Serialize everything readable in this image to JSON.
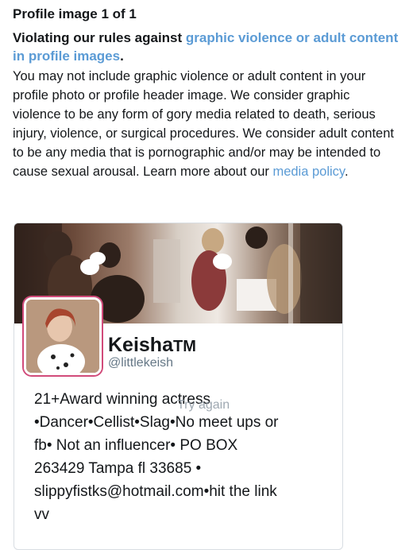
{
  "header": {
    "title": "Profile image 1 of 1"
  },
  "violation": {
    "prefix": "Violating our rules against ",
    "link_text": "graphic violence or adult content in profile images",
    "suffix": "."
  },
  "description": {
    "text": "You may not include graphic violence or adult content in your profile photo or profile header image. We consider graphic violence to be any form of gory media related to death, serious injury, violence, or surgical procedures. We consider adult content to be any media that is pornographic and/or may be intended to cause sexual arousal. Learn more about our ",
    "link_text": "media policy",
    "suffix": "."
  },
  "profile": {
    "name": "Keisha",
    "trademark": "TM",
    "handle": "@littlekeish",
    "bio_lines": [
      "21+Award winning actress",
      "•Dancer•Cellist•Slag•No meet ups or",
      "fb• Not an influencer• PO BOX",
      "263429 Tampa fl 33685 •",
      "slippyfistks@hotmail.com•hit the link",
      "vv"
    ],
    "overlay_text": "Try again"
  },
  "colors": {
    "link": "#5b9bd5",
    "avatar_border": "#d14b7a",
    "handle": "#657786"
  }
}
